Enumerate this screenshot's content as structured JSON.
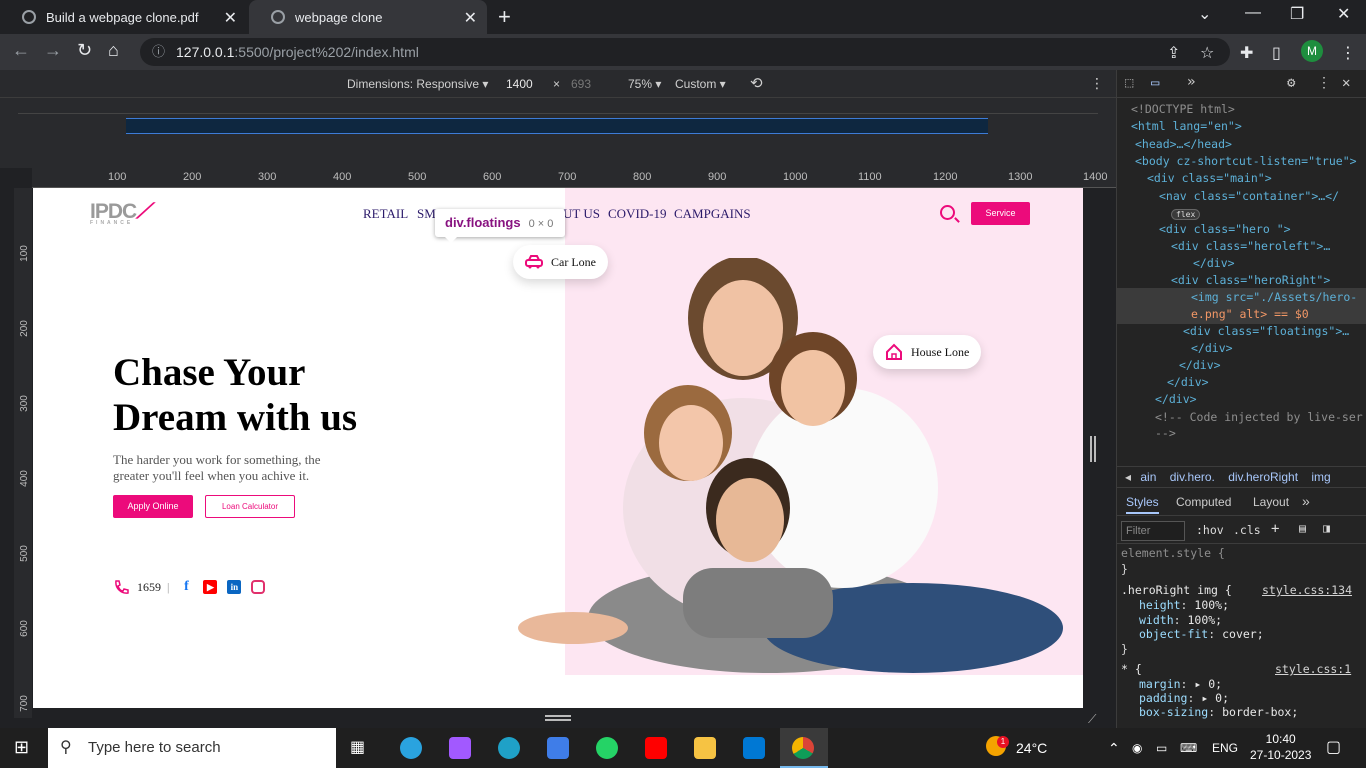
{
  "browser": {
    "tabs": [
      {
        "title": "Build a webpage clone.pdf"
      },
      {
        "title": "webpage clone"
      }
    ],
    "url_host": "127.0.0.1",
    "url_rest": ":5500/project%202/index.html",
    "profile_initial": "M"
  },
  "device_toolbar": {
    "dimensions_label": "Dimensions: Responsive",
    "width": "1400",
    "times": "×",
    "height": "693",
    "zoom": "75%",
    "throttle": "Custom"
  },
  "ruler": {
    "top": [
      "100",
      "200",
      "300",
      "400",
      "500",
      "600",
      "700",
      "800",
      "900",
      "1000",
      "1100",
      "1200",
      "1300",
      "1400"
    ],
    "left": [
      "100",
      "200",
      "300",
      "400",
      "500",
      "600",
      "700"
    ]
  },
  "site": {
    "logo_text": "IPDC",
    "logo_sub": "FINANCE",
    "nav": [
      "RETAIL",
      "SM",
      "UT US",
      "COVID-19",
      "CAMPGAINS"
    ],
    "service_button": "Service",
    "tooltip_selector": "div.floatings",
    "tooltip_size": "0 × 0",
    "car_loan": "Car Lone",
    "house_loan": "House Lone",
    "title_line1": "Chase Your",
    "title_line2": "Dream with us",
    "subtitle": "The harder you work for something, the greater you'll feel when you achive it.",
    "apply_button": "Apply Online",
    "loan_button": "Loan Calculator",
    "phone": "1659",
    "separator": "|"
  },
  "devtools": {
    "elements": [
      "<!DOCTYPE html>",
      "<html lang=\"en\">",
      "<head>…</head>",
      "<body cz-shortcut-listen=\"true\">",
      "<div class=\"main\">",
      "<nav class=\"container\">…</",
      "flex",
      "<div class=\"hero \">",
      "<div class=\"heroleft\">…",
      "</div>",
      "<div class=\"heroRight\">",
      "<img src=\"./Assets/hero-",
      "e.png\" alt> == $0",
      "<div class=\"floatings\">…",
      "</div>",
      "</div>",
      "</div>",
      "</div>",
      "<!-- Code injected by live-ser",
      "-->"
    ],
    "breadcrumbs": [
      "ain",
      "div.hero.",
      "div.heroRight",
      "img"
    ],
    "subtabs": [
      "Styles",
      "Computed",
      "Layout"
    ],
    "filter_placeholder": "Filter",
    "hov": ":hov",
    "cls": ".cls",
    "css": {
      "element_style": "element.style {",
      "close": "}",
      "rule1_selector": ".heroRight img {",
      "rule1_source": "style.css:134",
      "rule1_props": [
        [
          "height",
          "100%;"
        ],
        [
          "width",
          "100%;"
        ],
        [
          "object-fit",
          "cover;"
        ]
      ],
      "rule2_selector": "* {",
      "rule2_source": "style.css:1",
      "rule2_props": [
        [
          "margin",
          "▸ 0;"
        ],
        [
          "padding",
          "▸ 0;"
        ],
        [
          "box-sizing",
          "border-box;"
        ]
      ]
    }
  },
  "taskbar": {
    "search_placeholder": "Type here to search",
    "weather": "24°C",
    "weather_badge": "1",
    "lang": "ENG",
    "time": "10:40",
    "date": "27-10-2023"
  },
  "colors": {
    "brand_pink": "#ec0b7b",
    "nav_text": "#2b1a6a",
    "hero_pink_bg": "#fde6f2"
  }
}
